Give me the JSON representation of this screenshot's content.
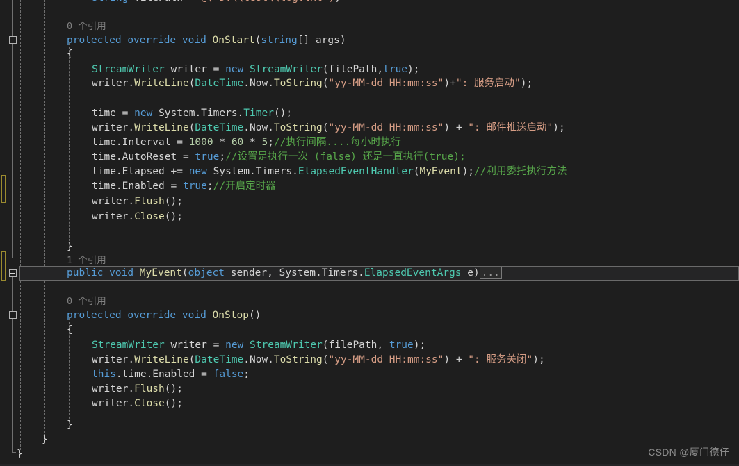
{
  "editor": {
    "theme_background": "#1e1e1e",
    "selection_background": "#252526",
    "colors": {
      "keyword": "#569cd6",
      "type": "#4ec9b0",
      "method": "#dcdcaa",
      "string": "#d69d85",
      "comment": "#57a64a",
      "number": "#b5cea8",
      "plain": "#d4d4d4",
      "codelens": "#808080",
      "changebar": "#9b8b2f"
    },
    "collapsed_region_label": "...",
    "codelens": {
      "onstart_refs": "0 个引用",
      "myevent_refs": "1 个引用",
      "onstop_refs": "0 个引用"
    },
    "lines": [
      {
        "id": "l-clipped",
        "indent": 0,
        "text": "string filePath = @(\"D:\\\\test\\\\log.txt\");"
      },
      {
        "id": "l-lens-1",
        "indent": 0,
        "text": "0 个引用"
      },
      {
        "id": "l-onstart",
        "indent": 0,
        "text": "protected override void OnStart(string[] args)"
      },
      {
        "id": "l-brace-1",
        "indent": 0,
        "text": "{"
      },
      {
        "id": "l-sw-1",
        "indent": 1,
        "text": "StreamWriter writer = new StreamWriter(filePath,true);"
      },
      {
        "id": "l-wl-1",
        "indent": 1,
        "text": "writer.WriteLine(DateTime.Now.ToString(\"yy-MM-dd HH:mm:ss\")+\": 服务启动\");"
      },
      {
        "id": "l-blank-1",
        "indent": 1,
        "text": ""
      },
      {
        "id": "l-timer-new",
        "indent": 1,
        "text": "time = new System.Timers.Timer();"
      },
      {
        "id": "l-wl-2",
        "indent": 1,
        "text": "writer.WriteLine(DateTime.Now.ToString(\"yy-MM-dd HH:mm:ss\") + \": 邮件推送启动\");"
      },
      {
        "id": "l-interval",
        "indent": 1,
        "text": "time.Interval = 1000 * 60 * 5;//执行间隔....每小时执行"
      },
      {
        "id": "l-autoreset",
        "indent": 1,
        "text": "time.AutoReset = true;//设置是执行一次 (false) 还是一直执行(true);"
      },
      {
        "id": "l-elapsed",
        "indent": 1,
        "text": "time.Elapsed += new System.Timers.ElapsedEventHandler(MyEvent);//利用委托执行方法"
      },
      {
        "id": "l-enabled",
        "indent": 1,
        "text": "time.Enabled = true;//开启定时器"
      },
      {
        "id": "l-flush-1",
        "indent": 1,
        "text": "writer.Flush();"
      },
      {
        "id": "l-close-1",
        "indent": 1,
        "text": "writer.Close();"
      },
      {
        "id": "l-blank-2",
        "indent": 1,
        "text": ""
      },
      {
        "id": "l-brace-2",
        "indent": 0,
        "text": "}"
      },
      {
        "id": "l-lens-2",
        "indent": 0,
        "text": "1 个引用"
      },
      {
        "id": "l-myevent",
        "indent": 0,
        "text": "public void MyEvent(object sender, System.Timers.ElapsedEventArgs e)..."
      },
      {
        "id": "l-blank-3",
        "indent": 0,
        "text": ""
      },
      {
        "id": "l-lens-3",
        "indent": 0,
        "text": "0 个引用"
      },
      {
        "id": "l-onstop",
        "indent": 0,
        "text": "protected override void OnStop()"
      },
      {
        "id": "l-brace-3",
        "indent": 0,
        "text": "{"
      },
      {
        "id": "l-sw-2",
        "indent": 1,
        "text": "StreamWriter writer = new StreamWriter(filePath, true);"
      },
      {
        "id": "l-wl-3",
        "indent": 1,
        "text": "writer.WriteLine(DateTime.Now.ToString(\"yy-MM-dd HH:mm:ss\") + \": 服务关闭\");"
      },
      {
        "id": "l-thistime",
        "indent": 1,
        "text": "this.time.Enabled = false;"
      },
      {
        "id": "l-flush-2",
        "indent": 1,
        "text": "writer.Flush();"
      },
      {
        "id": "l-close-2",
        "indent": 1,
        "text": "writer.Close();"
      },
      {
        "id": "l-blank-4",
        "indent": 1,
        "text": ""
      },
      {
        "id": "l-brace-4",
        "indent": 0,
        "text": "}"
      },
      {
        "id": "l-brace-5",
        "indent": 0,
        "text": "}"
      },
      {
        "id": "l-brace-6",
        "indent": 0,
        "text": "}"
      }
    ],
    "selected_line_id": "l-myevent"
  },
  "watermark": {
    "text": "CSDN @厦门德仔"
  }
}
